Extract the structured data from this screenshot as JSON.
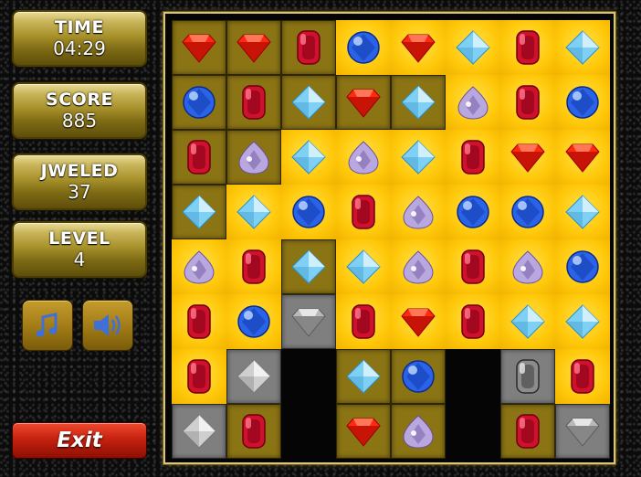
{
  "hud": {
    "time_label": "TIME",
    "time_value": "04:29",
    "score_label": "SCORE",
    "score_value": "885",
    "jeweled_label": "JWELED",
    "jeweled_value": "37",
    "level_label": "LEVEL",
    "level_value": "4"
  },
  "controls": {
    "music_icon": "music-note-icon",
    "sound_icon": "speaker-icon",
    "exit_label": "Exit"
  },
  "colors": {
    "tile_yellow": "#ffc80a",
    "tile_olive": "#8a7414",
    "tile_gray": "#7f7f7f",
    "exit_red": "#c52210",
    "panel_gold": "#a8922c"
  },
  "board": {
    "rows": [
      [
        {
          "gem": "ruby",
          "tile": "d"
        },
        {
          "gem": "ruby",
          "tile": "d"
        },
        {
          "gem": "garnet",
          "tile": "d"
        },
        {
          "gem": "sapphire",
          "tile": "y"
        },
        {
          "gem": "ruby",
          "tile": "y"
        },
        {
          "gem": "diamond",
          "tile": "y"
        },
        {
          "gem": "garnet",
          "tile": "y"
        },
        {
          "gem": "diamond",
          "tile": "y"
        }
      ],
      [
        {
          "gem": "sapphire",
          "tile": "d"
        },
        {
          "gem": "garnet",
          "tile": "d"
        },
        {
          "gem": "diamond",
          "tile": "d"
        },
        {
          "gem": "ruby",
          "tile": "d"
        },
        {
          "gem": "diamond",
          "tile": "d"
        },
        {
          "gem": "amethyst",
          "tile": "y"
        },
        {
          "gem": "garnet",
          "tile": "y"
        },
        {
          "gem": "sapphire",
          "tile": "y"
        }
      ],
      [
        {
          "gem": "garnet",
          "tile": "d"
        },
        {
          "gem": "amethyst",
          "tile": "d"
        },
        {
          "gem": "diamond",
          "tile": "y"
        },
        {
          "gem": "amethyst",
          "tile": "y"
        },
        {
          "gem": "diamond",
          "tile": "y"
        },
        {
          "gem": "garnet",
          "tile": "y"
        },
        {
          "gem": "ruby",
          "tile": "y"
        },
        {
          "gem": "ruby",
          "tile": "y"
        }
      ],
      [
        {
          "gem": "diamond",
          "tile": "d"
        },
        {
          "gem": "diamond",
          "tile": "y"
        },
        {
          "gem": "sapphire",
          "tile": "y"
        },
        {
          "gem": "garnet",
          "tile": "y"
        },
        {
          "gem": "amethyst",
          "tile": "y"
        },
        {
          "gem": "sapphire",
          "tile": "y"
        },
        {
          "gem": "sapphire",
          "tile": "y"
        },
        {
          "gem": "diamond",
          "tile": "y"
        }
      ],
      [
        {
          "gem": "amethyst",
          "tile": "y"
        },
        {
          "gem": "garnet",
          "tile": "y"
        },
        {
          "gem": "diamond",
          "tile": "d"
        },
        {
          "gem": "diamond",
          "tile": "y"
        },
        {
          "gem": "amethyst",
          "tile": "y"
        },
        {
          "gem": "garnet",
          "tile": "y"
        },
        {
          "gem": "amethyst",
          "tile": "y"
        },
        {
          "gem": "sapphire",
          "tile": "y"
        }
      ],
      [
        {
          "gem": "garnet",
          "tile": "y"
        },
        {
          "gem": "sapphire",
          "tile": "y"
        },
        {
          "gem": "silver-ruby",
          "tile": "g"
        },
        {
          "gem": "garnet",
          "tile": "y"
        },
        {
          "gem": "ruby",
          "tile": "y"
        },
        {
          "gem": "garnet",
          "tile": "y"
        },
        {
          "gem": "diamond",
          "tile": "y"
        },
        {
          "gem": "diamond",
          "tile": "y"
        }
      ],
      [
        {
          "gem": "garnet",
          "tile": "y"
        },
        {
          "gem": "silver-diamond",
          "tile": "g"
        },
        {
          "gem": "",
          "tile": "e"
        },
        {
          "gem": "diamond",
          "tile": "d"
        },
        {
          "gem": "sapphire",
          "tile": "d"
        },
        {
          "gem": "",
          "tile": "e"
        },
        {
          "gem": "silver-garnet",
          "tile": "g"
        },
        {
          "gem": "garnet",
          "tile": "y"
        }
      ],
      [
        {
          "gem": "silver-diamond",
          "tile": "g"
        },
        {
          "gem": "garnet",
          "tile": "d"
        },
        {
          "gem": "",
          "tile": "e"
        },
        {
          "gem": "ruby",
          "tile": "d"
        },
        {
          "gem": "amethyst",
          "tile": "d"
        },
        {
          "gem": "",
          "tile": "e"
        },
        {
          "gem": "garnet",
          "tile": "d"
        },
        {
          "gem": "silver-ruby",
          "tile": "g"
        }
      ]
    ]
  }
}
